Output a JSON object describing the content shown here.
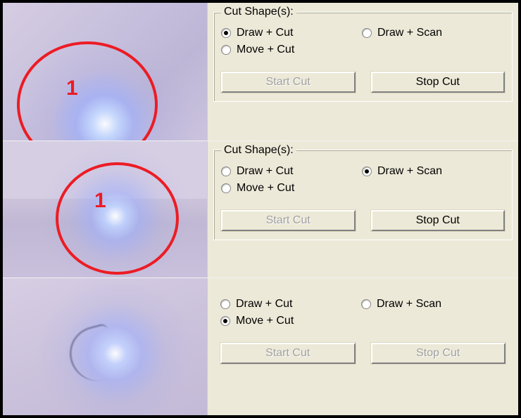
{
  "rows": [
    {
      "id": "row1",
      "annotation": {
        "circle": true,
        "label": "1"
      },
      "group": {
        "show_legend": true,
        "legend": "Cut Shape(s):",
        "options": {
          "draw_cut": {
            "label": "Draw + Cut",
            "selected": true
          },
          "draw_scan": {
            "label": "Draw + Scan",
            "selected": false
          },
          "move_cut": {
            "label": "Move + Cut",
            "selected": false
          }
        },
        "buttons": {
          "start": {
            "label": "Start Cut",
            "enabled": false
          },
          "stop": {
            "label": "Stop Cut",
            "enabled": true
          }
        }
      }
    },
    {
      "id": "row2",
      "annotation": {
        "circle": true,
        "label": "1"
      },
      "group": {
        "show_legend": true,
        "legend": "Cut Shape(s):",
        "options": {
          "draw_cut": {
            "label": "Draw + Cut",
            "selected": false
          },
          "draw_scan": {
            "label": "Draw + Scan",
            "selected": true
          },
          "move_cut": {
            "label": "Move + Cut",
            "selected": false
          }
        },
        "buttons": {
          "start": {
            "label": "Start Cut",
            "enabled": false
          },
          "stop": {
            "label": "Stop Cut",
            "enabled": true
          }
        }
      }
    },
    {
      "id": "row3",
      "annotation": {
        "circle": false,
        "label": ""
      },
      "group": {
        "show_legend": false,
        "legend": "",
        "options": {
          "draw_cut": {
            "label": "Draw + Cut",
            "selected": false
          },
          "draw_scan": {
            "label": "Draw + Scan",
            "selected": false
          },
          "move_cut": {
            "label": "Move + Cut",
            "selected": true
          }
        },
        "buttons": {
          "start": {
            "label": "Start Cut",
            "enabled": false
          },
          "stop": {
            "label": "Stop Cut",
            "enabled": false
          }
        }
      }
    }
  ],
  "colors": {
    "panel_bg": "#ece9d8",
    "annotation_red": "#ec1c24"
  }
}
